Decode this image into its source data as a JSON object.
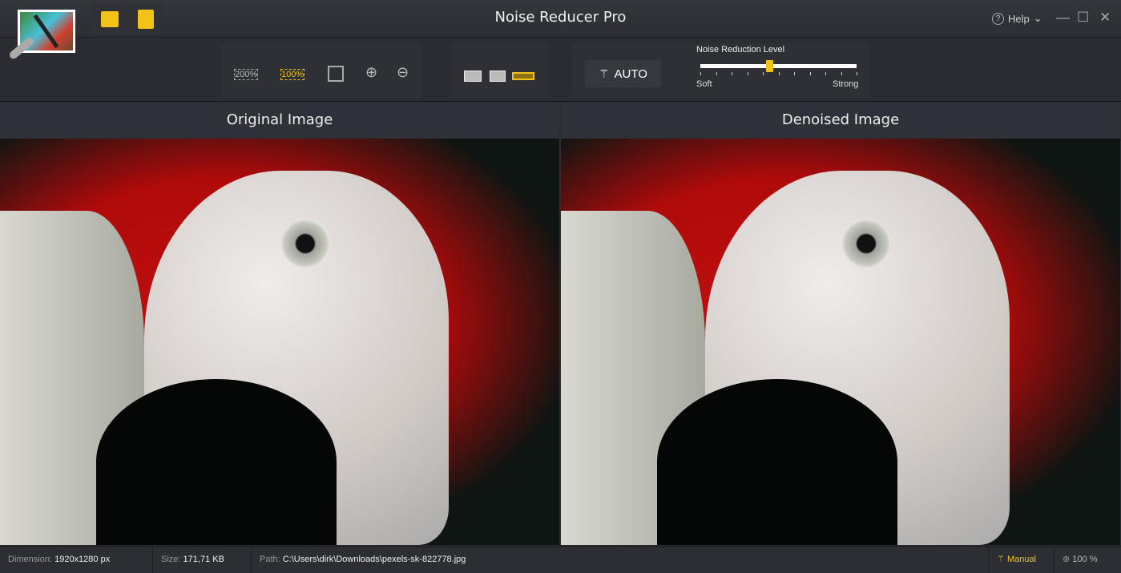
{
  "window": {
    "title": "Noise Reducer Pro",
    "help_label": "Help"
  },
  "toolbar": {
    "zoom_200": "200%",
    "zoom_100": "100%",
    "auto_label": "AUTO",
    "slider_label": "Noise Reduction Level",
    "slider_min_label": "Soft",
    "slider_max_label": "Strong",
    "slider_value": 0.44
  },
  "panels": {
    "left": "Original Image",
    "right": "Denoised Image"
  },
  "status": {
    "dimension_label": "Dimension:",
    "dimension": "1920x1280 px",
    "size_label": "Size:",
    "size": "171,71 KB",
    "path_label": "Path:",
    "path": "C:\\Users\\dirk\\Downloads\\pexels-sk-822778.jpg",
    "mode": "Manual",
    "zoom": "100 %"
  },
  "colors": {
    "accent": "#f2c218"
  }
}
